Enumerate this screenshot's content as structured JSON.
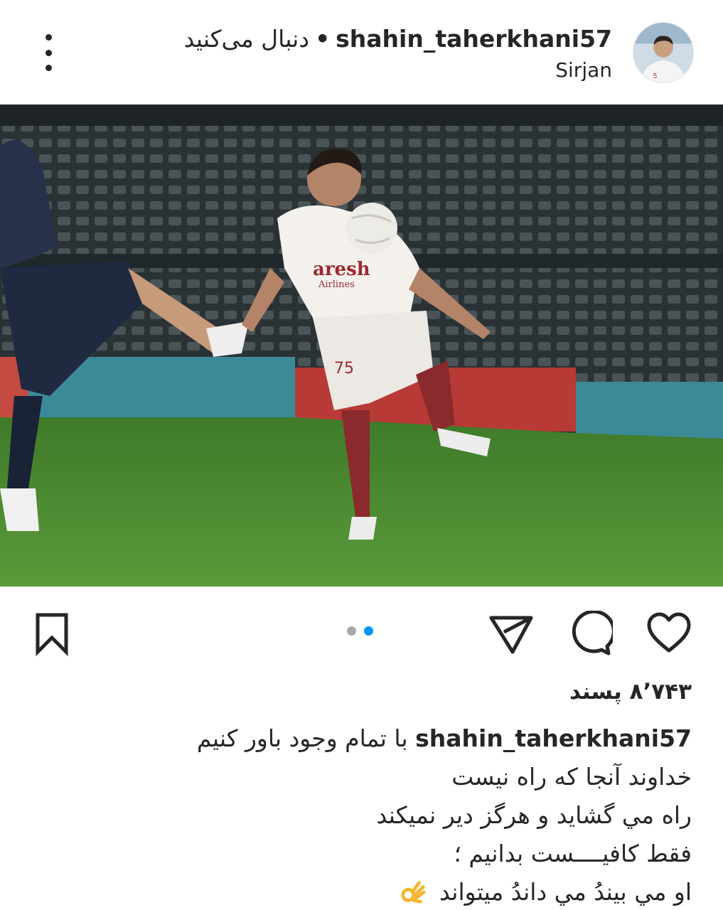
{
  "header": {
    "username": "shahin_taherkhani57",
    "follow_text": "دنبال می‌کنید",
    "separator": "•",
    "location": "Sirjan",
    "avatar_icon": "profile-avatar",
    "more_icon": "more-options-icon"
  },
  "post": {
    "image_texts": {
      "sponsor": "aresh",
      "sponsor_sub": "Airlines",
      "shirt_number": "75",
      "avatar_number": "5"
    },
    "carousel": {
      "total": 2,
      "active": 2
    }
  },
  "actions": {
    "bookmark_icon": "bookmark-icon",
    "share_icon": "send-icon",
    "comment_icon": "comment-icon",
    "like_icon": "heart-icon"
  },
  "likes": {
    "count": "۸٬۷۴۳",
    "label": "پسند"
  },
  "caption": {
    "username": "shahin_taherkhani57",
    "lines": [
      "با تمام وجود باور کنیم",
      "خداوند آنجا که راه نیست",
      "راه مي گشايد و هرگز دير نميكند",
      "فقط كافيــــست بدانيم ؛",
      "او مي بيندُ مي داندُ ميتواند"
    ],
    "emoji": "ok-hand-emoji"
  },
  "colors": {
    "accent_blue": "#0095f6",
    "text": "#262626",
    "inactive_dot": "#a8a8a8"
  }
}
